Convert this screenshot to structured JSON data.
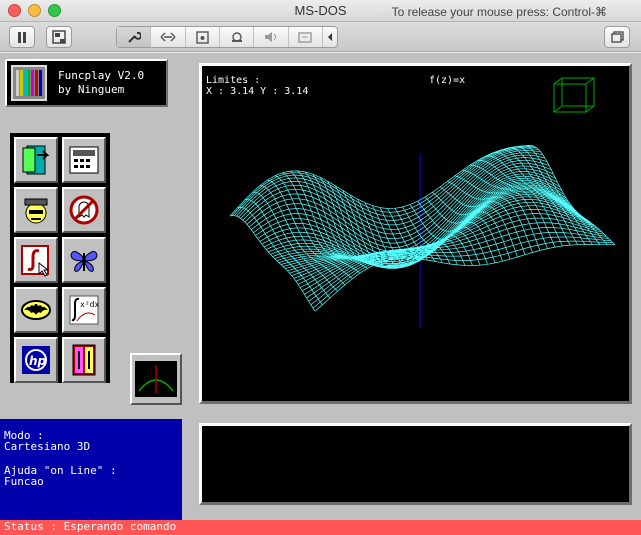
{
  "window": {
    "title": "MS-DOS",
    "release_hint": "To release your mouse press: Control-⌘"
  },
  "toolbar": {
    "pause_icon": "pause-icon",
    "disk_icon": "disk-icon",
    "tools": [
      "wrench-icon",
      "arrows-icon",
      "floppy-icon",
      "camera-icon",
      "speaker-icon",
      "rotate-icon",
      "chevron-left-icon"
    ],
    "window_icon": "window-icon"
  },
  "app": {
    "title_line1": "Funcplay V2.0",
    "title_line2": "by Ninguem",
    "stripes": [
      "#d0d0d0",
      "#d2c800",
      "#00b8c8",
      "#00b400",
      "#c800c8",
      "#c80000",
      "#0000c8"
    ]
  },
  "plot": {
    "limits_label": "Limites :",
    "limits_values": "X : 3.14 Y : 3.14",
    "function_label": "f(z)=x",
    "mesh_color": "#55ffff",
    "axis_color": "#0000aa",
    "cube_color": "#00aa00"
  },
  "info": {
    "modo_label": "Modo :",
    "modo_value": "Cartesiano 3D",
    "ajuda_label": "Ajuda \"on Line\" :",
    "ajuda_value": "Funcao"
  },
  "status": {
    "text": "Status : Esperando comando"
  }
}
